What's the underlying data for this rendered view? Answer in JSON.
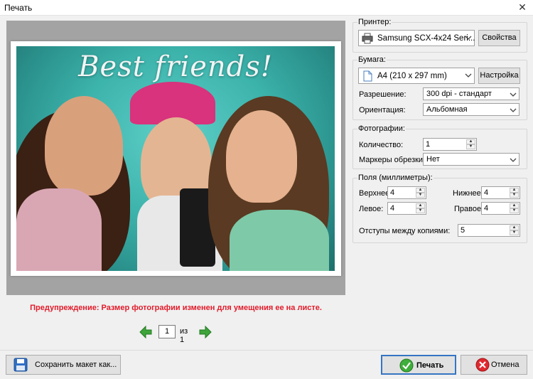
{
  "window": {
    "title": "Печать",
    "close_glyph": "✕"
  },
  "preview": {
    "photo_title": "Best friends!",
    "warning": "Предупреждение: Размер фотографии изменен для умещения ее на листе.",
    "page_current": "1",
    "page_of": "из 1"
  },
  "printer": {
    "label": "Принтер:",
    "selected": "Samsung SCX-4x24 Seri...",
    "properties_button": "Свойства"
  },
  "paper": {
    "label": "Бумага:",
    "selected": "A4 (210 x 297 mm)",
    "setup_button": "Настройка",
    "resolution_label": "Разрешение:",
    "resolution_value": "300 dpi - стандарт",
    "orientation_label": "Ориентация:",
    "orientation_value": "Альбомная"
  },
  "photos": {
    "label": "Фотографии:",
    "count_label": "Количество:",
    "count_value": "1",
    "crop_label": "Маркеры обрезки:",
    "crop_value": "Нет"
  },
  "margins": {
    "label": "Поля (миллиметры):",
    "top_label": "Верхнее:",
    "top_value": "4",
    "bottom_label": "Нижнее:",
    "bottom_value": "4",
    "left_label": "Левое:",
    "left_value": "4",
    "right_label": "Правое:",
    "right_value": "4",
    "gap_label": "Отступы между копиями:",
    "gap_value": "5"
  },
  "footer": {
    "save_layout_button": "Сохранить макет как...",
    "print_button": "Печать",
    "cancel_button": "Отмена"
  },
  "colors": {
    "warning": "#e21b2a",
    "accent": "#3575c4",
    "arrow": "#3ea43a"
  }
}
